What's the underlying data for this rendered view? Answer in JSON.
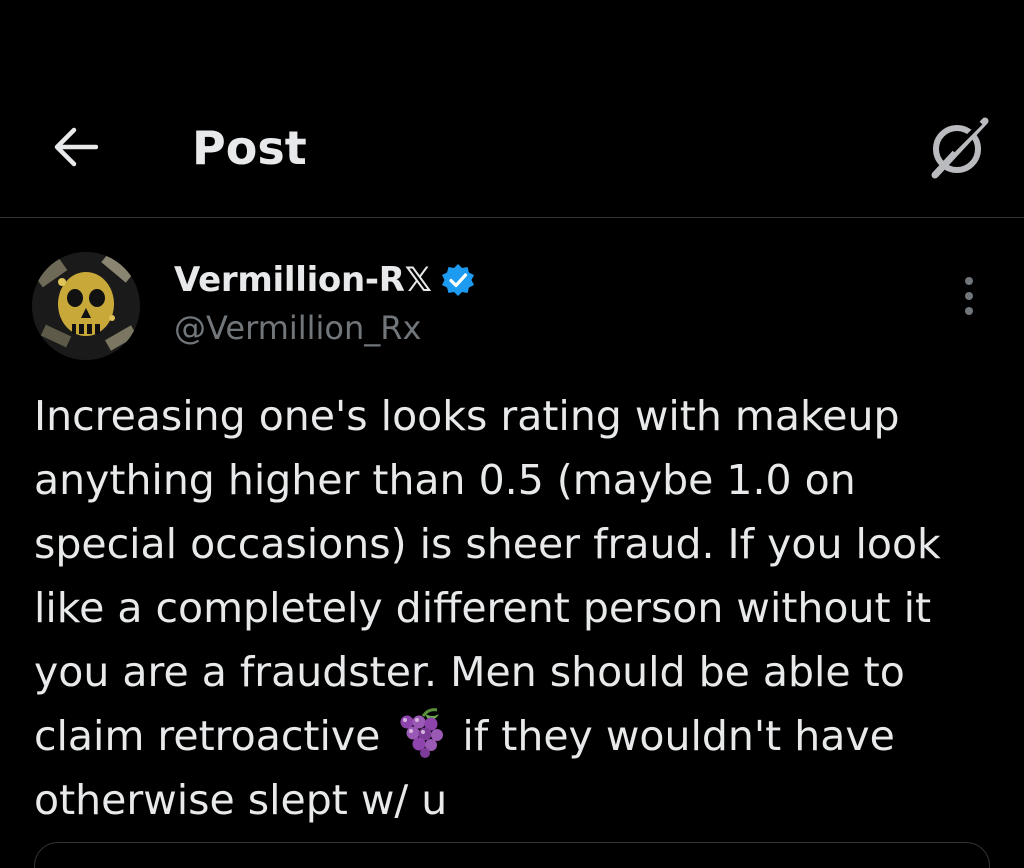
{
  "header": {
    "title": "Post",
    "back_icon": "arrow-left-icon",
    "grok_icon": "grok-icon"
  },
  "author": {
    "display_name": "Vermillion-R𝕏",
    "handle": "@Vermillion_Rx",
    "verified": true,
    "verified_color": "#1d9bf0"
  },
  "post": {
    "text_part1": "Increasing one's looks rating with makeup anything higher than 0.5 (maybe 1.0 on special occasions) is sheer fraud. If you look like a completely different person without it you are a fraudster. Men should be able to claim retroactive ",
    "emoji_icon": "grapes-emoji-icon",
    "text_part2": " if they wouldn't have otherwise slept w/ u"
  },
  "colors": {
    "background": "#000000",
    "text_primary": "#e7e9ea",
    "text_secondary": "#71767b",
    "divider": "#2f3336",
    "accent": "#1d9bf0"
  }
}
